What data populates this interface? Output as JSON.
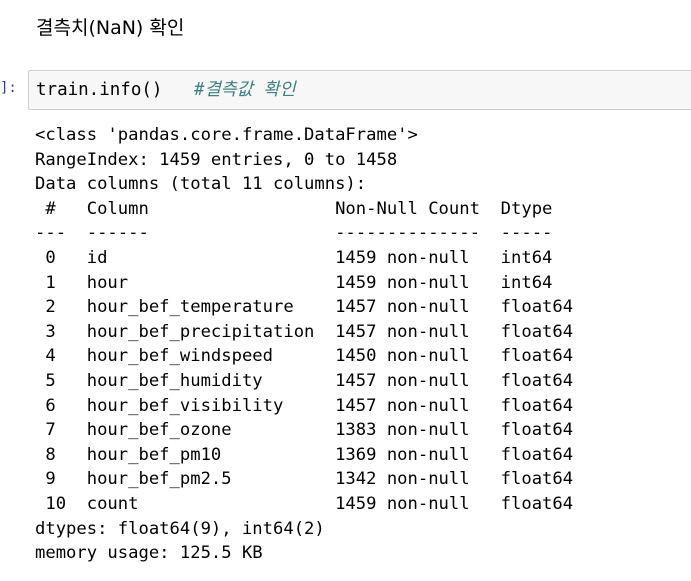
{
  "markdown": {
    "heading": "결측치(NaN) 확인"
  },
  "cell": {
    "prompt": "]:",
    "code": "train.info()",
    "code_gap": "   ",
    "comment": "#결측값 확인"
  },
  "output": {
    "lines": [
      "<class 'pandas.core.frame.DataFrame'>",
      "RangeIndex: 1459 entries, 0 to 1458",
      "Data columns (total 11 columns):",
      " #   Column                  Non-Null Count  Dtype  ",
      "---  ------                  --------------  -----  ",
      " 0   id                      1459 non-null   int64  ",
      " 1   hour                    1459 non-null   int64  ",
      " 2   hour_bef_temperature    1457 non-null   float64",
      " 3   hour_bef_precipitation  1457 non-null   float64",
      " 4   hour_bef_windspeed      1450 non-null   float64",
      " 5   hour_bef_humidity       1457 non-null   float64",
      " 6   hour_bef_visibility     1457 non-null   float64",
      " 7   hour_bef_ozone          1383 non-null   float64",
      " 8   hour_bef_pm10           1369 non-null   float64",
      " 9   hour_bef_pm2.5          1342 non-null   float64",
      " 10  count                   1459 non-null   float64",
      "dtypes: float64(9), int64(2)",
      "memory usage: 125.5 KB"
    ]
  }
}
